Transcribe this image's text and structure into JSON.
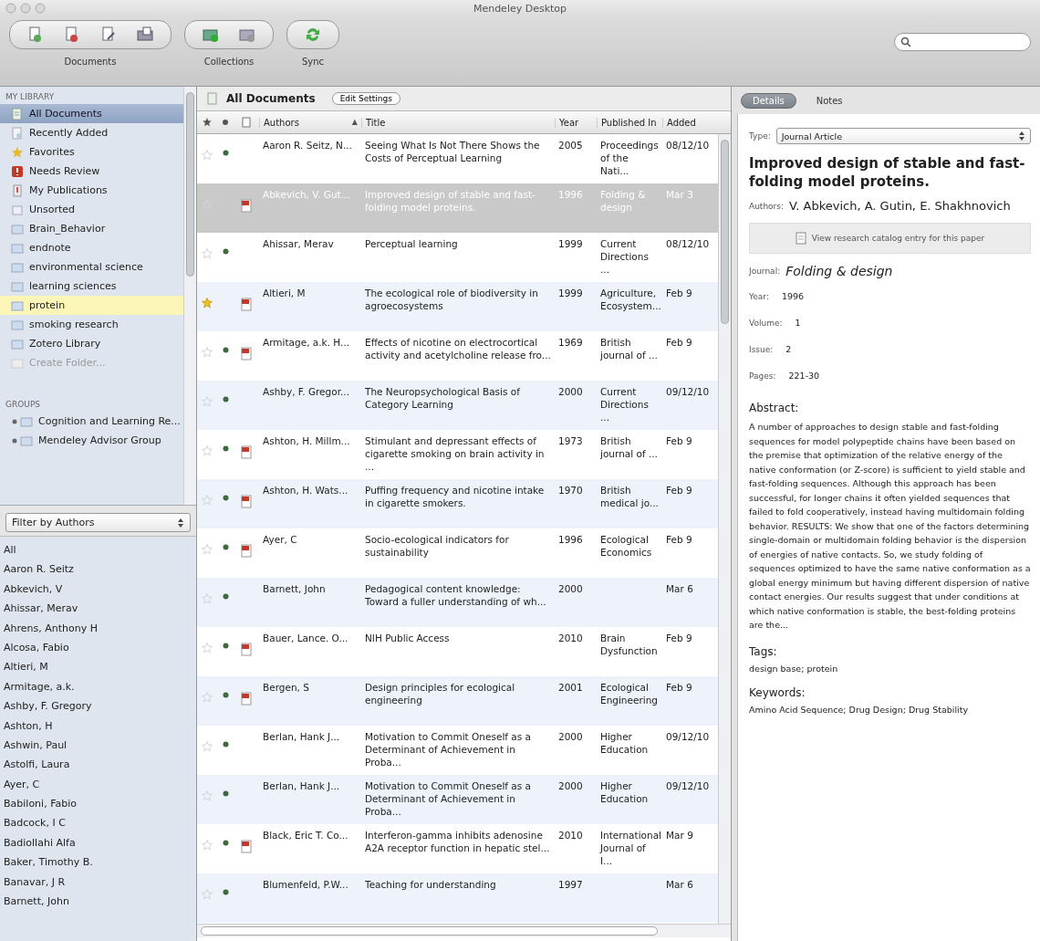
{
  "window": {
    "title": "Mendeley Desktop"
  },
  "toolbar": {
    "groups": [
      {
        "kind": "documents",
        "label": "Documents"
      },
      {
        "kind": "collections",
        "label": "Collections"
      },
      {
        "kind": "sync",
        "label": "Sync"
      }
    ]
  },
  "sidebar": {
    "library_heading": "MY LIBRARY",
    "library_items": [
      {
        "kind": "all",
        "label": "All Documents",
        "selected": true,
        "highlighted": false,
        "disabled": false
      },
      {
        "kind": "recent",
        "label": "Recently Added",
        "selected": false,
        "highlighted": false,
        "disabled": false
      },
      {
        "kind": "favorites",
        "label": "Favorites",
        "selected": false,
        "highlighted": false,
        "disabled": false
      },
      {
        "kind": "review",
        "label": "Needs Review",
        "selected": false,
        "highlighted": false,
        "disabled": false
      },
      {
        "kind": "publications",
        "label": "My Publications",
        "selected": false,
        "highlighted": false,
        "disabled": false
      },
      {
        "kind": "unsorted",
        "label": "Unsorted",
        "selected": false,
        "highlighted": false,
        "disabled": false
      },
      {
        "kind": "folder",
        "label": "Brain_Behavior",
        "selected": false,
        "highlighted": false,
        "disabled": false
      },
      {
        "kind": "folder",
        "label": "endnote",
        "selected": false,
        "highlighted": false,
        "disabled": false
      },
      {
        "kind": "folder",
        "label": "environmental science",
        "selected": false,
        "highlighted": false,
        "disabled": false
      },
      {
        "kind": "folder",
        "label": "learning sciences",
        "selected": false,
        "highlighted": false,
        "disabled": false
      },
      {
        "kind": "folder",
        "label": "protein",
        "selected": false,
        "highlighted": true,
        "disabled": false
      },
      {
        "kind": "folder",
        "label": "smoking research",
        "selected": false,
        "highlighted": false,
        "disabled": false
      },
      {
        "kind": "folder",
        "label": "Zotero Library",
        "selected": false,
        "highlighted": false,
        "disabled": false
      },
      {
        "kind": "create",
        "label": "Create Folder...",
        "selected": false,
        "highlighted": false,
        "disabled": true
      }
    ],
    "groups_heading": "GROUPS",
    "groups": [
      {
        "label": "Cognition and Learning Re..."
      },
      {
        "label": "Mendeley Advisor Group"
      }
    ],
    "filter": {
      "value": "Filter by Authors"
    },
    "authors": [
      {
        "label": "All",
        "selected": false
      },
      {
        "label": "Aaron R. Seitz",
        "selected": false
      },
      {
        "label": "Abkevich, V",
        "selected": false
      },
      {
        "label": "Ahissar, Merav",
        "selected": false
      },
      {
        "label": "Ahrens, Anthony H",
        "selected": false
      },
      {
        "label": "Alcosa, Fabio",
        "selected": false
      },
      {
        "label": "Altieri, M",
        "selected": false
      },
      {
        "label": "Armitage, a.k.",
        "selected": false
      },
      {
        "label": "Ashby, F. Gregory",
        "selected": false
      },
      {
        "label": "Ashton, H",
        "selected": false
      },
      {
        "label": "Ashwin, Paul",
        "selected": false
      },
      {
        "label": "Astolfi, Laura",
        "selected": false
      },
      {
        "label": "Ayer, C",
        "selected": false
      },
      {
        "label": "Babiloni, Fabio",
        "selected": false
      },
      {
        "label": "Badcock, I C",
        "selected": false
      },
      {
        "label": "Badiollahi Alfa",
        "selected": false
      },
      {
        "label": "Baker, Timothy B.",
        "selected": false
      },
      {
        "label": "Banavar, J R",
        "selected": false
      },
      {
        "label": "Barnett, John",
        "selected": false
      }
    ]
  },
  "documents": {
    "title": "All Documents",
    "edit_button": "Edit Settings",
    "columns": [
      "Authors",
      "Title",
      "Year",
      "Published In",
      "Added"
    ],
    "sort_indicator": "▲",
    "rows": [
      {
        "favorite": false,
        "unread": true,
        "pdf": false,
        "selected": false,
        "authors": "Aaron R. Seitz, N...",
        "title": "Seeing What Is Not There Shows the Costs of Perceptual Learning",
        "year": "2005",
        "published_in": "Proceedings of the Nati...",
        "added": "08/12/10"
      },
      {
        "favorite": false,
        "unread": false,
        "pdf": true,
        "selected": true,
        "authors": "Abkevich, V. Gut...",
        "title": "Improved design of stable and fast-folding model proteins.",
        "year": "1996",
        "published_in": "Folding & design",
        "added": "Mar 3"
      },
      {
        "favorite": false,
        "unread": true,
        "pdf": false,
        "selected": false,
        "authors": "Ahissar, Merav",
        "title": "Perceptual learning",
        "year": "1999",
        "published_in": "Current Directions ...",
        "added": "08/12/10"
      },
      {
        "favorite": true,
        "unread": false,
        "pdf": true,
        "selected": false,
        "authors": "Altieri, M",
        "title": "The ecological role of biodiversity in agroecosystems",
        "year": "1999",
        "published_in": "Agriculture, Ecosystem...",
        "added": "Feb 9"
      },
      {
        "favorite": false,
        "unread": true,
        "pdf": true,
        "selected": false,
        "authors": "Armitage, a.k. H...",
        "title": "Effects of nicotine on electrocortical activity and acetylcholine release fro...",
        "year": "1969",
        "published_in": "British journal of ...",
        "added": "Feb 9"
      },
      {
        "favorite": false,
        "unread": true,
        "pdf": false,
        "selected": false,
        "authors": "Ashby, F. Gregor...",
        "title": "The Neuropsychological Basis of Category Learning",
        "year": "2000",
        "published_in": "Current Directions ...",
        "added": "09/12/10"
      },
      {
        "favorite": false,
        "unread": true,
        "pdf": true,
        "selected": false,
        "authors": "Ashton, H. Millm...",
        "title": "Stimulant and depressant effects of cigarette smoking on brain activity in ...",
        "year": "1973",
        "published_in": "British journal of ...",
        "added": "Feb 9"
      },
      {
        "favorite": false,
        "unread": true,
        "pdf": true,
        "selected": false,
        "authors": "Ashton, H. Wats...",
        "title": "Puffing frequency and nicotine intake in cigarette smokers.",
        "year": "1970",
        "published_in": "British medical jo...",
        "added": "Feb 9"
      },
      {
        "favorite": false,
        "unread": true,
        "pdf": true,
        "selected": false,
        "authors": "Ayer, C",
        "title": "Socio-ecological indicators for sustainability",
        "year": "1996",
        "published_in": "Ecological Economics",
        "added": "Feb 9"
      },
      {
        "favorite": false,
        "unread": true,
        "pdf": false,
        "selected": false,
        "authors": "Barnett, John",
        "title": "Pedagogical content knowledge: Toward a fuller understanding of wh...",
        "year": "2000",
        "added": "Mar 6"
      },
      {
        "favorite": false,
        "unread": true,
        "pdf": true,
        "selected": false,
        "authors": "Bauer, Lance. O...",
        "title": "NIH Public Access",
        "year": "2010",
        "published_in": "Brain Dysfunction",
        "added": "Feb 9"
      },
      {
        "favorite": false,
        "unread": true,
        "pdf": true,
        "selected": false,
        "authors": "Bergen, S",
        "title": "Design principles for ecological engineering",
        "year": "2001",
        "published_in": "Ecological Engineering",
        "added": "Feb 9"
      },
      {
        "favorite": false,
        "unread": true,
        "pdf": false,
        "selected": false,
        "authors": "Berlan, Hank J...",
        "title": "Motivation to Commit Oneself as a Determinant of Achievement in Proba...",
        "year": "2000",
        "published_in": "Higher Education",
        "added": "09/12/10"
      },
      {
        "favorite": false,
        "unread": true,
        "pdf": false,
        "selected": false,
        "authors": "Berlan, Hank J...",
        "title": "Motivation to Commit Oneself as a Determinant of Achievement in Proba...",
        "year": "2000",
        "published_in": "Higher Education",
        "added": "09/12/10"
      },
      {
        "favorite": false,
        "unread": true,
        "pdf": true,
        "selected": false,
        "authors": "Black, Eric T. Co...",
        "title": "Interferon-gamma inhibits adenosine A2A receptor function in hepatic stel...",
        "year": "2010",
        "published_in": "International Journal of I...",
        "added": "Mar 9"
      },
      {
        "favorite": false,
        "unread": true,
        "pdf": false,
        "selected": false,
        "authors": "Blumenfeld, P.W...",
        "title": "Teaching for understanding",
        "year": "1997",
        "added": "Mar 6"
      }
    ]
  },
  "details": {
    "tabs": [
      {
        "label": "Details",
        "selected": true
      },
      {
        "label": "Notes",
        "selected": false
      }
    ],
    "type_label": "Type:",
    "type_value": "Journal Article",
    "title": "Improved design of stable and fast-folding model proteins.",
    "authors_label": "Authors:",
    "authors": "V. Abkevich, A. Gutin, E. Shakhnovich",
    "catalog_button": "View research catalog entry for this paper",
    "journal_label": "Journal:",
    "journal": "Folding & design",
    "fields": [
      {
        "label": "Year:",
        "value": "1996"
      },
      {
        "label": "Volume:",
        "value": "1"
      },
      {
        "label": "Issue:",
        "value": "2"
      },
      {
        "label": "Pages:",
        "value": "221-30"
      }
    ],
    "abstract_heading": "Abstract:",
    "abstract": "A number of approaches to design stable and fast-folding sequences for model polypeptide chains have been based on the premise that optimization of the relative energy of the native conformation (or Z-score) is sufficient to yield stable and fast-folding sequences. Although this approach has been successful, for longer chains it often yielded sequences that failed to fold cooperatively, instead having multidomain folding behavior. RESULTS: We show that one of the factors determining single-domain or multidomain folding behavior is the dispersion of energies of native contacts. So, we study folding of sequences optimized to have the same native conformation as a global energy minimum but having different dispersion of native contact energies. Our results suggest that under conditions at which native conformation is stable, the best-folding proteins are the...",
    "tags_heading": "Tags:",
    "tags": "design base; protein",
    "keywords_heading": "Keywords:",
    "keywords": "Amino Acid Sequence; Drug Design; Drug Stability"
  }
}
